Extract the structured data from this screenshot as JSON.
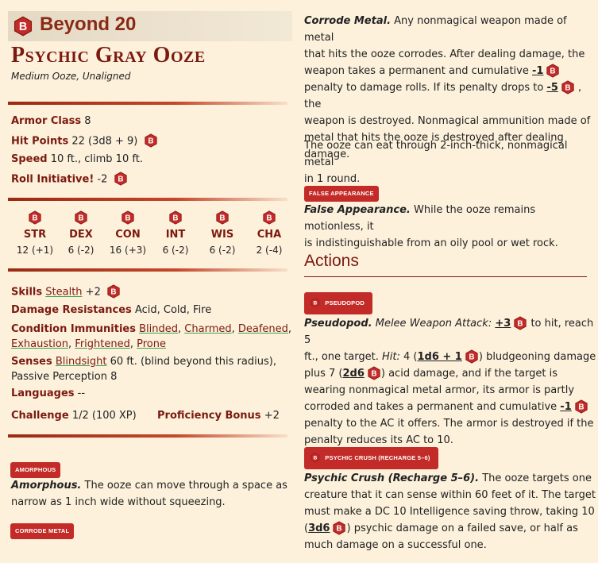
{
  "colors": {
    "accent": "#7a1a10",
    "chip": "#c22b28",
    "background": "#fdf1dc"
  },
  "header": {
    "brand": "Beyond 20",
    "logo_letter": "B"
  },
  "monster": {
    "name": "Psychic Gray Ooze",
    "meta": "Medium Ooze, Unaligned"
  },
  "stats": {
    "armor_class_label": "Armor Class",
    "armor_class": "8",
    "hp_label": "Hit Points",
    "hp": "22 (3d8 + 9)",
    "speed_label": "Speed",
    "speed": "10 ft., climb 10 ft.",
    "init_label": "Roll Initiative!",
    "init": "-2"
  },
  "abilities": [
    {
      "name": "STR",
      "value": "12 (+1)"
    },
    {
      "name": "DEX",
      "value": "6 (-2)"
    },
    {
      "name": "CON",
      "value": "16 (+3)"
    },
    {
      "name": "INT",
      "value": "6 (-2)"
    },
    {
      "name": "WIS",
      "value": "6 (-2)"
    },
    {
      "name": "CHA",
      "value": "2 (-4)"
    }
  ],
  "details": {
    "skills_label": "Skills",
    "skill_name": "Stealth",
    "skill_value": "+2",
    "resist_label": "Damage Resistances",
    "resist": "Acid, Cold, Fire",
    "cond_label": "Condition Immunities",
    "conditions": [
      "Blinded",
      "Charmed",
      "Deafened",
      "Exhaustion",
      "Frightened",
      "Prone"
    ],
    "senses_label": "Senses",
    "senses_link": "Blindsight",
    "senses_rest": "60 ft. (blind beyond this radius),",
    "senses_line2": "Passive Perception 8",
    "languages_label": "Languages",
    "languages": "--",
    "challenge_label": "Challenge",
    "challenge": "1/2 (100 XP)",
    "prof_label": "Proficiency Bonus",
    "prof": "+2"
  },
  "traits": {
    "amorphous_chip": "AMORPHOUS",
    "amorphous_title": "Amorphous.",
    "amorphous_text_1": "The ooze can move through a space as",
    "amorphous_text_2": "narrow as 1 inch wide without squeezing.",
    "corrode_chip": "CORRODE METAL",
    "corrode_title": "Corrode Metal.",
    "corrode_1": "Any nonmagical weapon made of metal",
    "corrode_2": "that hits the ooze corrodes. After dealing damage, the",
    "corrode_3a": "weapon takes a permanent and cumulative",
    "corrode_3b": "-1",
    "corrode_4": "penalty to damage rolls. If its penalty drops to",
    "corrode_4b": "-5",
    "corrode_4c": ", the",
    "corrode_5": "weapon is destroyed. Nonmagical ammunition made of",
    "corrode_6": "metal that hits the ooze is destroyed after dealing",
    "corrode_7": "damage.",
    "corrode_8": "The ooze can eat through 2-inch-thick, nonmagical metal",
    "corrode_9": "in 1 round.",
    "false_chip": "FALSE APPEARANCE",
    "false_title": "False Appearance.",
    "false_1": "While the ooze remains motionless, it",
    "false_2": "is indistinguishable from an oily pool or wet rock."
  },
  "actions": {
    "heading": "Actions",
    "pseudopod_chip": "PSEUDOPOD",
    "pseudo_title": "Pseudopod.",
    "pseudo_type": "Melee Weapon Attack:",
    "pseudo_bonus": "+3",
    "pseudo_1b": "to hit, reach 5",
    "pseudo_2a": "ft., one target.",
    "pseudo_hit": "Hit:",
    "pseudo_2b": "4 (",
    "pseudo_dmg1": "1d6 + 1",
    "pseudo_2c": ") bludgeoning damage",
    "pseudo_3a": "plus 7 (",
    "pseudo_dmg2": "2d6",
    "pseudo_3b": ") acid damage, and if the target is",
    "pseudo_4": "wearing nonmagical metal armor, its armor is partly",
    "pseudo_5a": "corroded and takes a permanent and cumulative",
    "pseudo_5b": "-1",
    "pseudo_6": "penalty to the AC it offers. The armor is destroyed if the",
    "pseudo_7": "penalty reduces its AC to 10.",
    "psychic_chip": "PSYCHIC CRUSH (RECHARGE 5–6)",
    "psychic_title": "Psychic Crush (Recharge 5–6).",
    "psychic_1": "The ooze targets one",
    "psychic_2": "creature that it can sense within 60 feet of it. The target",
    "psychic_3": "must make a DC 10 Intelligence saving throw, taking 10",
    "psychic_4a": "(",
    "psychic_dmg": "3d6",
    "psychic_4b": ") psychic damage on a failed save, or half as",
    "psychic_5": "much damage on a successful one."
  }
}
